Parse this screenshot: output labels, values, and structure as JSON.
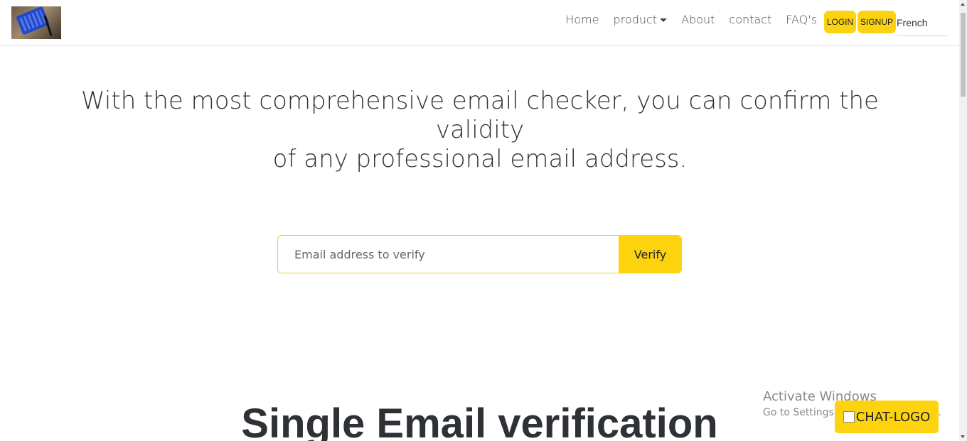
{
  "header": {
    "nav": [
      {
        "label": "Home"
      },
      {
        "label": "product"
      },
      {
        "label": "About"
      },
      {
        "label": "contact"
      },
      {
        "label": "FAQ's"
      }
    ],
    "login_label": "LOGIN",
    "signup_label": "SIGNUP",
    "language": "French"
  },
  "hero": {
    "title_line1": "With the most comprehensive email checker, you can confirm the validity",
    "title_line2": "of any professional email address.",
    "input_placeholder": "Email address to verify",
    "verify_label": "Verify"
  },
  "section": {
    "title": "Single Email verification"
  },
  "watermark": {
    "title": "Activate Windows",
    "subtitle": "Go to Settings to activate Windows."
  },
  "chat": {
    "label": "CHAT-LOGO"
  },
  "colors": {
    "accent": "#fdd310",
    "input_border": "#f1cf1d",
    "text": "#333333"
  }
}
